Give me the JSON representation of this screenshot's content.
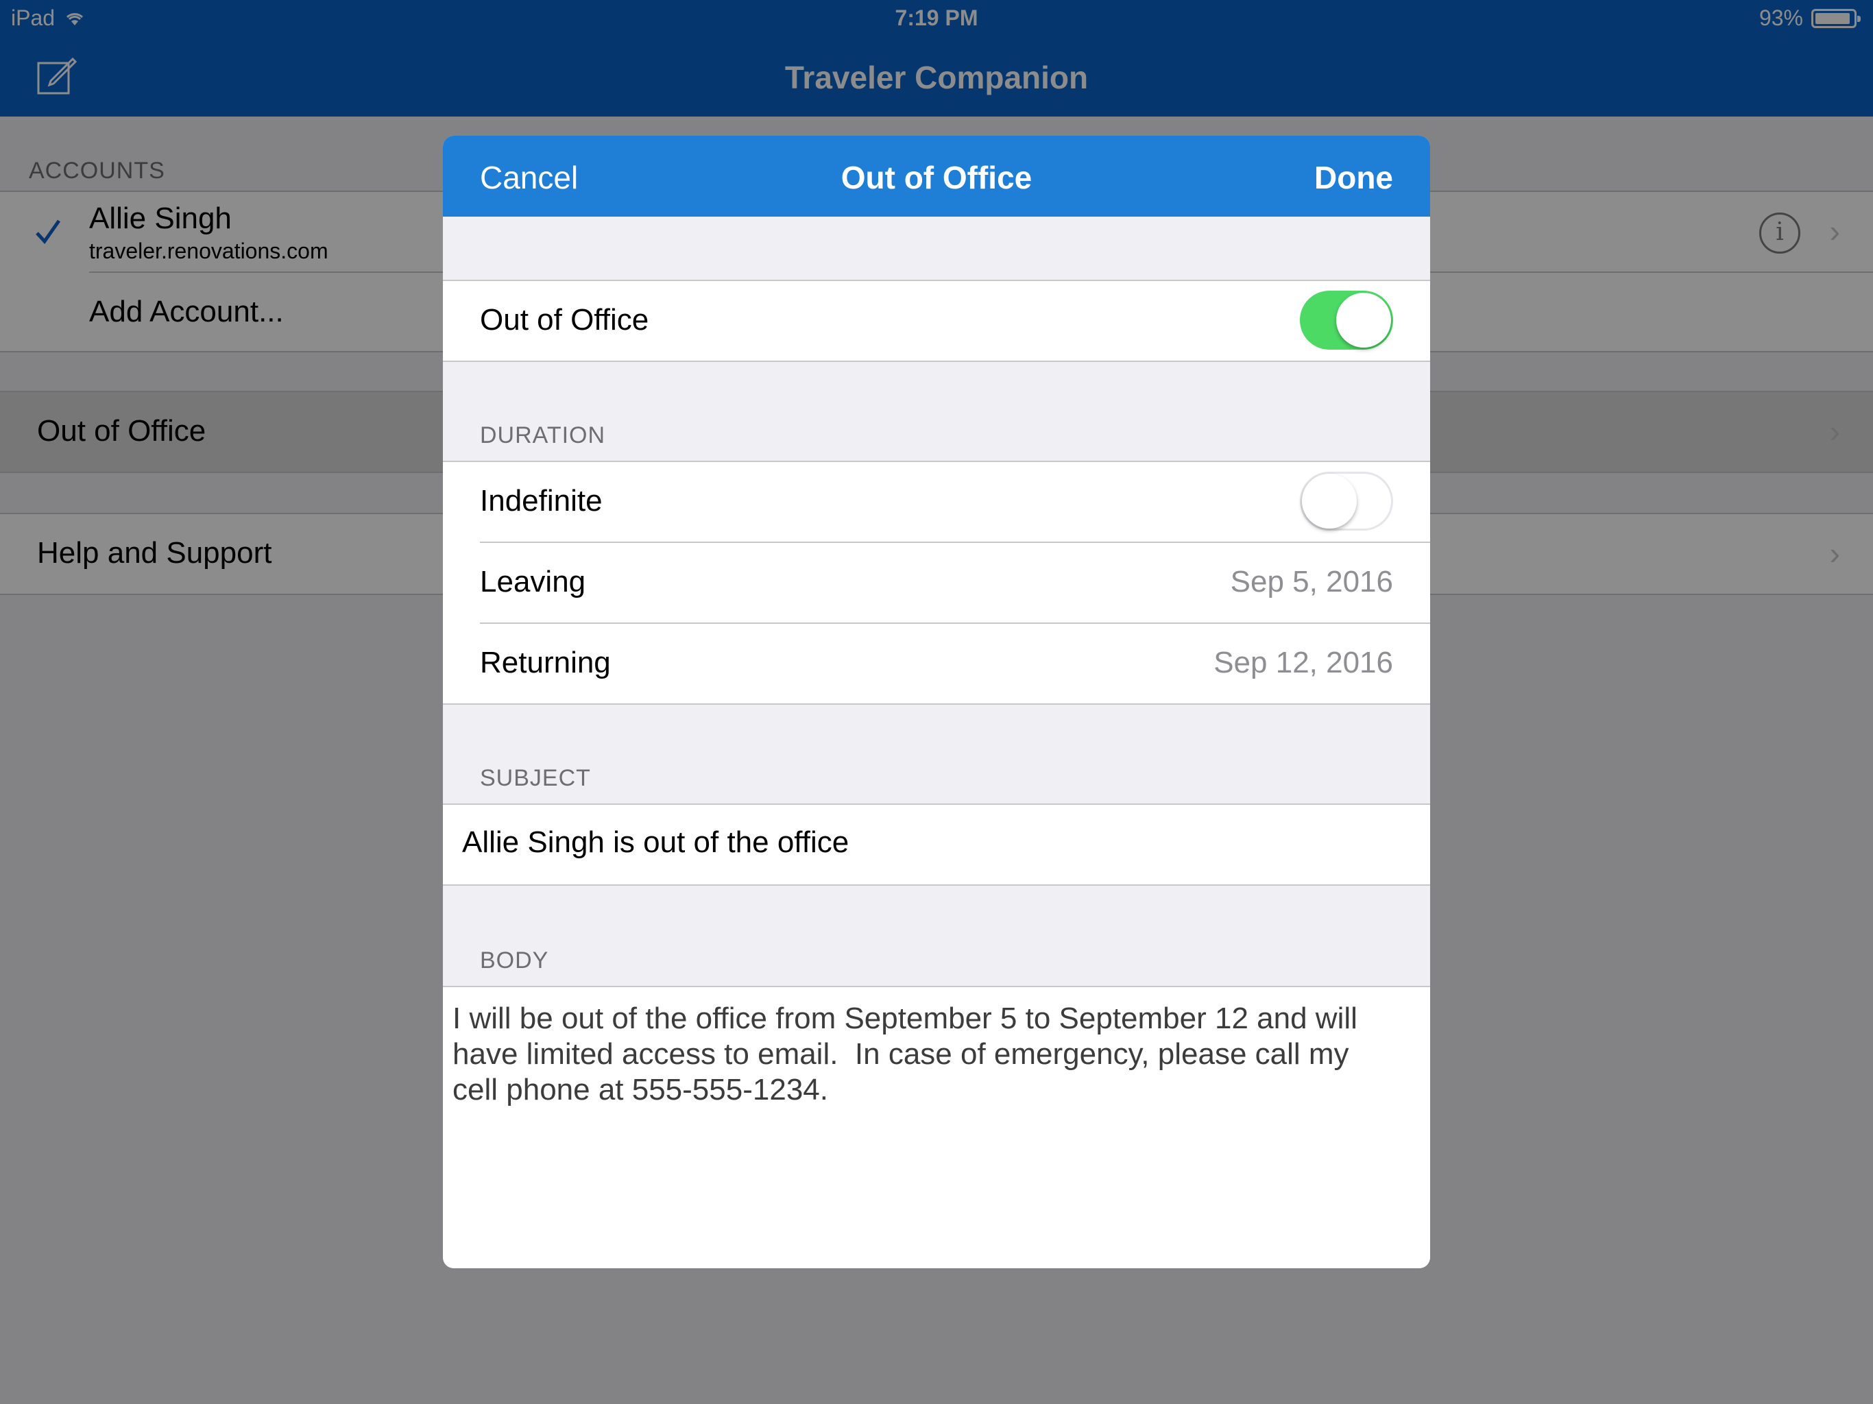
{
  "status_bar": {
    "device": "iPad",
    "time": "7:19 PM",
    "battery_percent": "93%",
    "battery_level": 0.93,
    "icons": [
      "wifi-icon",
      "battery-icon"
    ]
  },
  "app": {
    "title": "Traveler Companion",
    "compose_icon": "compose-icon",
    "brand_color": "#0a65c8"
  },
  "sidebar": {
    "accounts_header": "ACCOUNTS",
    "account": {
      "name": "Allie Singh",
      "server": "traveler.renovations.com",
      "selected_icon": "checkmark-icon",
      "info_icon": "info-icon"
    },
    "add_account_label": "Add Account...",
    "out_of_office_label": "Out of Office",
    "help_label": "Help and Support"
  },
  "modal": {
    "cancel_label": "Cancel",
    "title": "Out of Office",
    "done_label": "Done",
    "header_color": "#1f7fd6",
    "out_of_office": {
      "label": "Out of Office",
      "enabled": true
    },
    "duration": {
      "header": "DURATION",
      "indefinite_label": "Indefinite",
      "indefinite_enabled": false,
      "leaving_label": "Leaving",
      "leaving_value": "Sep 5, 2016",
      "returning_label": "Returning",
      "returning_value": "Sep 12, 2016"
    },
    "subject": {
      "header": "SUBJECT",
      "value": "Allie Singh is out of the office"
    },
    "body": {
      "header": "BODY",
      "value": "I will be out of the office from September 5 to September 12 and will\nhave limited access to email.  In case of emergency, please call my\ncell phone at 555-555-1234."
    }
  }
}
